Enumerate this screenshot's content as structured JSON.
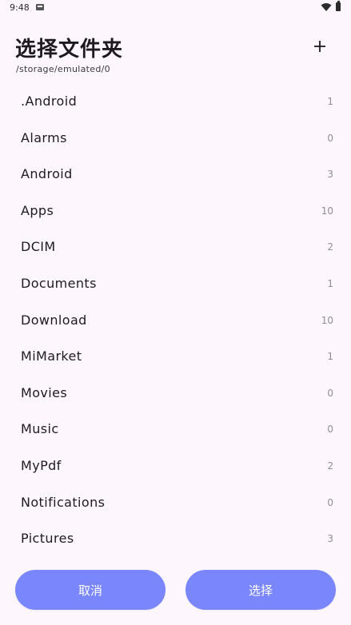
{
  "status_bar": {
    "time": "9:48",
    "icons": [
      "notification-icon",
      "wifi-icon",
      "battery-icon"
    ]
  },
  "header": {
    "title": "选择文件夹",
    "add_icon": "plus-icon",
    "path": "/storage/emulated/0"
  },
  "folders": [
    {
      "name": ".Android",
      "count": "1"
    },
    {
      "name": "Alarms",
      "count": "0"
    },
    {
      "name": "Android",
      "count": "3"
    },
    {
      "name": "Apps",
      "count": "10"
    },
    {
      "name": "DCIM",
      "count": "2"
    },
    {
      "name": "Documents",
      "count": "1"
    },
    {
      "name": "Download",
      "count": "10"
    },
    {
      "name": "MiMarket",
      "count": "1"
    },
    {
      "name": "Movies",
      "count": "0"
    },
    {
      "name": "Music",
      "count": "0"
    },
    {
      "name": "MyPdf",
      "count": "2"
    },
    {
      "name": "Notifications",
      "count": "0"
    },
    {
      "name": "Pictures",
      "count": "3"
    }
  ],
  "footer": {
    "cancel_label": "取消",
    "select_label": "选择"
  },
  "colors": {
    "background": "#fdf7fd",
    "button": "#7a86fb",
    "button_text": "#ffffff",
    "count_text": "#8e8e93"
  }
}
